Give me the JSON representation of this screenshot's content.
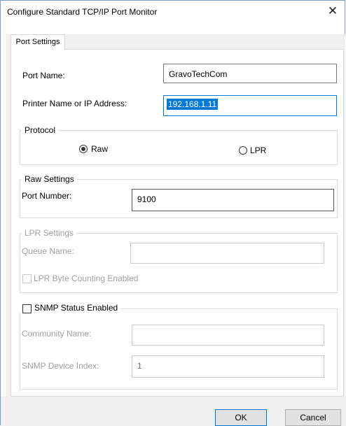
{
  "window": {
    "title": "Configure Standard TCP/IP Port Monitor",
    "close_glyph": "✕"
  },
  "tabs": [
    {
      "label": "Port Settings",
      "active": true
    }
  ],
  "port_name": {
    "label": "Port Name:",
    "value": "GravoTechCom"
  },
  "address": {
    "label": "Printer Name or IP Address:",
    "value": "192.168.1.11"
  },
  "protocol": {
    "title": "Protocol",
    "options": [
      {
        "label": "Raw",
        "checked": true
      },
      {
        "label": "LPR",
        "checked": false
      }
    ]
  },
  "raw_settings": {
    "title": "Raw Settings",
    "port_number_label": "Port Number:",
    "port_number_value": "9100"
  },
  "lpr_settings": {
    "title": "LPR Settings",
    "queue_name_label": "Queue Name:",
    "queue_name_value": "",
    "byte_counting_label": "LPR Byte Counting Enabled",
    "byte_counting_checked": false,
    "enabled": false
  },
  "snmp": {
    "title": "SNMP Status Enabled",
    "checked": false,
    "community_label": "Community Name:",
    "community_value": "",
    "device_index_label": "SNMP Device Index:",
    "device_index_value": "1"
  },
  "buttons": {
    "ok": "OK",
    "cancel": "Cancel"
  },
  "colors": {
    "accent": "#0078d7",
    "disabled_text": "#a0a0a0",
    "window_border": "#7a9cc6"
  },
  "icons": {
    "close": "close-icon"
  }
}
